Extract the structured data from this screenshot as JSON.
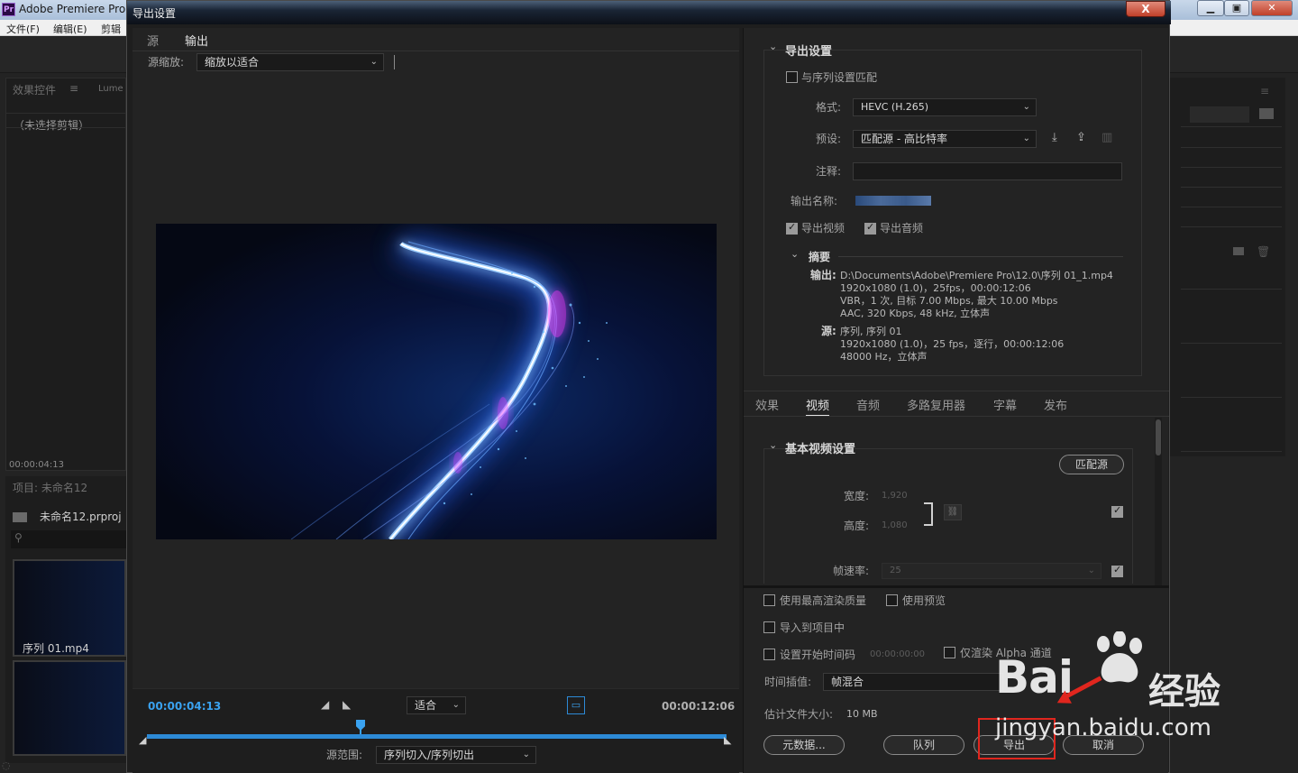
{
  "app": {
    "title": "Adobe Premiere Pro",
    "menu": [
      "文件(F)",
      "编辑(E)",
      "剪辑"
    ],
    "left_panel_tab": "效果控件",
    "left_panel_tab2": "Lume",
    "no_clip": "（未选择剪辑）",
    "left_timecode": "00:00:04:13",
    "project_title": "项目: 未命名12",
    "project_file": "未命名12.prproj",
    "clip_name": "序列 01.mp4"
  },
  "dialog": {
    "title": "导出设置",
    "close_label": "X",
    "left": {
      "tabs": [
        "源",
        "输出"
      ],
      "source_scale_label": "源缩放:",
      "source_scale_value": "缩放以适合",
      "current_time": "00:00:04:13",
      "fit_value": "适合",
      "duration": "00:00:12:06",
      "source_range_label": "源范围:",
      "source_range_value": "序列切入/序列切出"
    },
    "export_settings": {
      "header": "导出设置",
      "match_sequence": "与序列设置匹配",
      "format_label": "格式:",
      "format_value": "HEVC (H.265)",
      "preset_label": "预设:",
      "preset_value": "匹配源 - 高比特率",
      "comment_label": "注释:",
      "output_name_label": "输出名称:",
      "export_video": "导出视频",
      "export_audio": "导出音频",
      "summary_header": "摘要",
      "output_label": "输出:",
      "output_lines": [
        "D:\\Documents\\Adobe\\Premiere Pro\\12.0\\序列 01_1.mp4",
        "1920x1080 (1.0)，25fps，00:00:12:06",
        "VBR，1 次, 目标 7.00 Mbps, 最大 10.00 Mbps",
        "AAC, 320 Kbps, 48 kHz, 立体声"
      ],
      "source_label": "源:",
      "source_lines": [
        "序列, 序列 01",
        "1920x1080 (1.0)，25 fps，逐行，00:00:12:06",
        "48000 Hz，立体声"
      ]
    },
    "tabs": [
      "效果",
      "视频",
      "音频",
      "多路复用器",
      "字幕",
      "发布"
    ],
    "video": {
      "header": "基本视频设置",
      "match_source": "匹配源",
      "width_label": "宽度:",
      "width_value": "1,920",
      "height_label": "高度:",
      "height_value": "1,080",
      "fps_label": "帧速率:",
      "fps_value": "25"
    },
    "bottom": {
      "max_render": "使用最高渲染质量",
      "use_preview": "使用预览",
      "import_project": "导入到项目中",
      "set_start_tc": "设置开始时间码",
      "start_tc_value": "00:00:00:00",
      "render_alpha": "仅渲染 Alpha 通道",
      "interp_label": "时间插值:",
      "interp_value": "帧混合",
      "est_size_label": "估计文件大小:",
      "est_size_value": "10 MB",
      "metadata_btn": "元数据...",
      "queue_btn": "队列",
      "export_btn": "导出",
      "cancel_btn": "取消"
    }
  },
  "watermark": {
    "brand": "Bai",
    "brand2": "经验",
    "url": "jingyan.baidu.com"
  }
}
